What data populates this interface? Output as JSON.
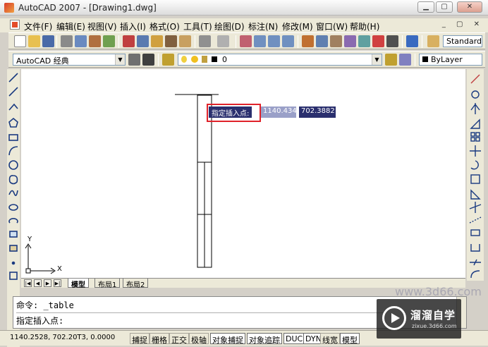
{
  "window": {
    "title": "AutoCAD 2007 - [Drawing1.dwg]",
    "min": "▁",
    "max": "▢",
    "close": "✕"
  },
  "menu": {
    "items": [
      "文件(F)",
      "编辑(E)",
      "视图(V)",
      "插入(I)",
      "格式(O)",
      "工具(T)",
      "绘图(D)",
      "标注(N)",
      "修改(M)",
      "窗口(W)",
      "帮助(H)"
    ],
    "mdi": "_ ▢ ✕"
  },
  "toolbar1": {
    "style_combo": "Standard"
  },
  "toolbar2": {
    "workspace_combo": "AutoCAD 经典",
    "layer_combo": "0",
    "color_combo": "ByLayer"
  },
  "drawing": {
    "prompt_label": "指定插入点:",
    "x_value": "1140.434",
    "y_value": "702.3882",
    "ucs_x": "X",
    "ucs_y": "Y"
  },
  "layout_tabs": [
    "模型",
    "布局1",
    "布局2"
  ],
  "command": {
    "line1": "命令: _table",
    "line2": "指定插入点:"
  },
  "status": {
    "coords": "1140.2528, 702.20T3, 0.0000",
    "buttons": [
      "捕捉",
      "栅格",
      "正交",
      "极轴",
      "对象捕捉",
      "对象追踪",
      "DUCS",
      "DYN",
      "线宽",
      "模型"
    ]
  },
  "watermark": {
    "title": "溜溜自学",
    "url": "zixue.3d66.com"
  },
  "colors": {
    "highlight_box": "#e0222a",
    "tooltip_bg": "#2a2f6e"
  }
}
